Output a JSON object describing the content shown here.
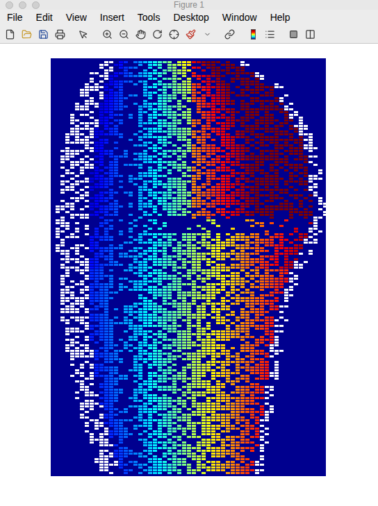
{
  "window": {
    "title": "Figure 1",
    "active": false
  },
  "menu": [
    {
      "label": "File"
    },
    {
      "label": "Edit"
    },
    {
      "label": "View"
    },
    {
      "label": "Insert"
    },
    {
      "label": "Tools"
    },
    {
      "label": "Desktop"
    },
    {
      "label": "Window"
    },
    {
      "label": "Help"
    }
  ]
}
